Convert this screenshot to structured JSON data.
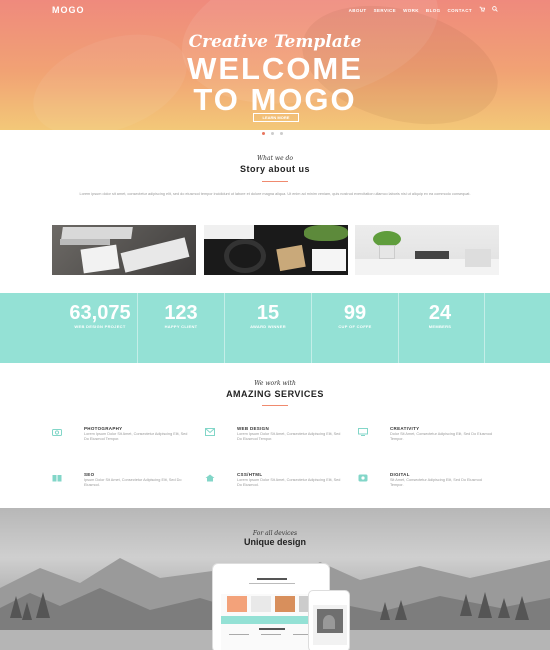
{
  "header": {
    "logo": "MOGO",
    "nav": [
      {
        "label": "ABOUT"
      },
      {
        "label": "SERVICE"
      },
      {
        "label": "WORK"
      },
      {
        "label": "BLOG"
      },
      {
        "label": "CONTACT"
      }
    ],
    "cart_icon": "cart-icon",
    "search_icon": "search-icon"
  },
  "hero": {
    "subtitle": "Creative Template",
    "title_line1": "WELCOME",
    "title_line2": "TO MOGO",
    "button": "LEARN MORE",
    "slides": 3,
    "active_slide": 1
  },
  "story": {
    "script": "What we do",
    "title": "Story about us",
    "text": "Lorem ipsum dolor sit amet, consectetur adipiscing elit, sed do eiusmod tempor incididunt ut labore et dolore magna aliqua. Ut enim ad minim veniam, quis nostrud exercitation ullamco laboris nisi ut aliquip ex ea commodo consequat."
  },
  "stats": [
    {
      "value": "63,075",
      "label": "WEB DESIGN PROJECT"
    },
    {
      "value": "123",
      "label": "HAPPY CLIENT"
    },
    {
      "value": "15",
      "label": "AWARD WINNER"
    },
    {
      "value": "99",
      "label": "CUP OF COFFE"
    },
    {
      "value": "24",
      "label": "MEMBERS"
    }
  ],
  "services": {
    "script": "We work with",
    "title": "AMAZING SERVICES",
    "items": [
      {
        "title": "PHOTOGRAPHY",
        "desc": "Lorem Ipsum Dolor Sit Amet, Consectetur Adipiscing Elit, Sed Do Eiusmod Tempor.",
        "icon": "camera-icon"
      },
      {
        "title": "WEB DESIGN",
        "desc": "Lorem Ipsum Dolor Sit Amet, Consectetur Adipiscing Elit, Sed Do Eiusmod Tempor.",
        "icon": "mail-icon"
      },
      {
        "title": "CREATIVITY",
        "desc": "Dolor Sit Amet, Consectetur Adipiscing Elit, Sed Do Eiusmod Tempor.",
        "icon": "monitor-icon"
      },
      {
        "title": "SEO",
        "desc": "Ipsum Dolor Sit Amet, Consectetur Adipiscing Elit, Sed Do Eiusmod.",
        "icon": "book-icon"
      },
      {
        "title": "CSS/HTML",
        "desc": "Lorem Ipsum Dolor Sit Amet, Consectetur Adipiscing Elit, Sed Do Eiusmod.",
        "icon": "home-icon"
      },
      {
        "title": "DIGITAL",
        "desc": "Sit Amet, Consectetur Adipiscing Elit, Sed Do Eiusmod Tempor.",
        "icon": "image-icon"
      }
    ]
  },
  "devices": {
    "script": "For all devices",
    "title": "Unique design"
  },
  "colors": {
    "hero_top": "#ef8a7d",
    "hero_bottom": "#f3c878",
    "accent": "#f08a6e",
    "teal": "#94e1d5",
    "icon_teal": "#82d6c8"
  }
}
